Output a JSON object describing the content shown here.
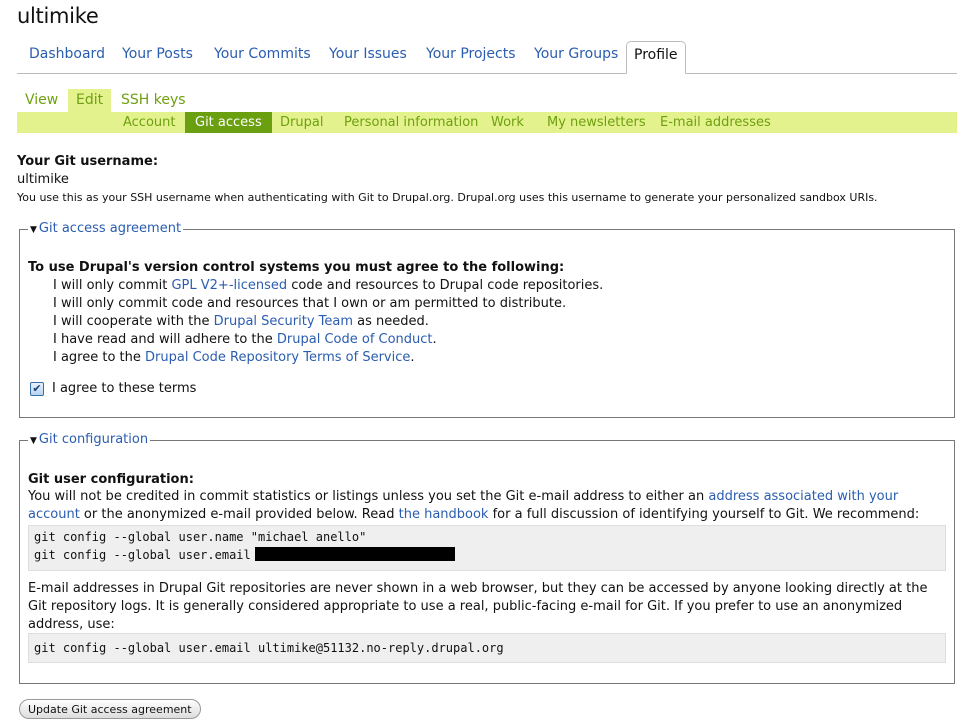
{
  "page_title": "ultimike",
  "primary_tabs": [
    "Dashboard",
    "Your Posts",
    "Your Commits",
    "Your Issues",
    "Your Projects",
    "Your Groups",
    "Profile"
  ],
  "secondary_tabs": [
    "View",
    "Edit",
    "SSH keys"
  ],
  "tertiary_tabs": [
    "Account",
    "Git access",
    "Drupal",
    "Personal information",
    "Work",
    "My newsletters",
    "E-mail addresses"
  ],
  "username": {
    "label": "Your Git username:",
    "value": "ultimike",
    "description": "You use this as your SSH username when authenticating with Git to Drupal.org. Drupal.org uses this username to generate your personalized sandbox URIs."
  },
  "agreement": {
    "legend": "Git access agreement",
    "heading": "To use Drupal's version control systems you must agree to the following:",
    "terms": [
      {
        "pre": "I will only commit ",
        "link": "GPL V2+-licensed",
        "post": " code and resources to Drupal code repositories."
      },
      {
        "pre": "I will only commit code and resources that I own or am permitted to distribute.",
        "link": "",
        "post": ""
      },
      {
        "pre": "I will cooperate with the ",
        "link": "Drupal Security Team",
        "post": " as needed."
      },
      {
        "pre": "I have read and will adhere to the ",
        "link": "Drupal Code of Conduct",
        "post": "."
      },
      {
        "pre": "I agree to the ",
        "link": "Drupal Code Repository Terms of Service",
        "post": "."
      }
    ],
    "checkbox_label": "I agree to these terms",
    "checked": true
  },
  "config": {
    "legend": "Git configuration",
    "heading": "Git user configuration:",
    "text_pre": "You will not be credited in commit statistics or listings unless you set the Git e-mail address to either an ",
    "text_link1": "address associated with your account",
    "text_mid": " or the anonymized e-mail provided below. Read ",
    "text_link2": "the handbook",
    "text_post": " for a full discussion of identifying yourself to Git. We recommend:",
    "code_line1": "git config --global user.name \"michael anello\"",
    "code_line2": "git config --global user.email",
    "note": "E-mail addresses in Drupal Git repositories are never shown in a web browser, but they can be accessed by anyone looking directly at the Git repository logs. It is generally considered appropriate to use a real, public-facing e-mail for Git. If you prefer to use an anonymized address, use:",
    "code_line3": "git config --global user.email ultimike@51132.no-reply.drupal.org"
  },
  "submit_label": "Update Git access agreement"
}
